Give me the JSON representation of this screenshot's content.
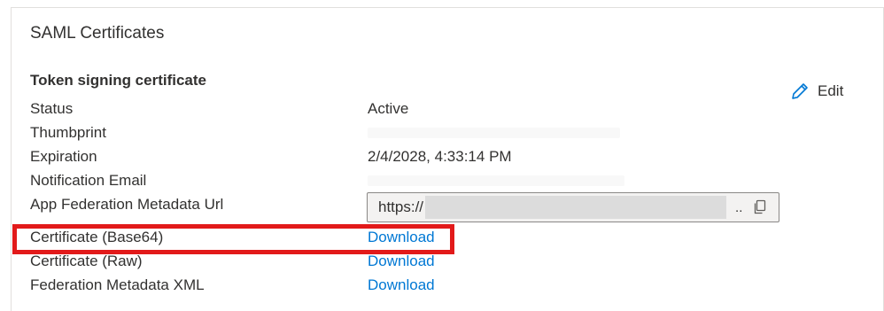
{
  "card": {
    "title": "SAML Certificates"
  },
  "token_signing": {
    "section_title": "Token signing certificate",
    "edit_label": "Edit",
    "edit_icon": "pencil-icon",
    "fields": {
      "status": {
        "label": "Status",
        "value": "Active"
      },
      "thumbprint": {
        "label": "Thumbprint"
      },
      "expiration": {
        "label": "Expiration",
        "value": "2/4/2028, 4:33:14 PM"
      },
      "notification_email": {
        "label": "Notification Email"
      },
      "metadata_url": {
        "label": "App Federation Metadata Url",
        "value_prefix": "https://",
        "truncation": "..",
        "copy_icon": "copy-icon"
      },
      "cert_base64": {
        "label": "Certificate (Base64)",
        "link": "Download"
      },
      "cert_raw": {
        "label": "Certificate (Raw)",
        "link": "Download"
      },
      "federation_xml": {
        "label": "Federation Metadata XML",
        "link": "Download"
      }
    }
  },
  "annotation": {
    "highlight_color": "#e21a1a"
  },
  "colors": {
    "link": "#0078d4",
    "text": "#323130",
    "border": "#e1dfdd"
  }
}
